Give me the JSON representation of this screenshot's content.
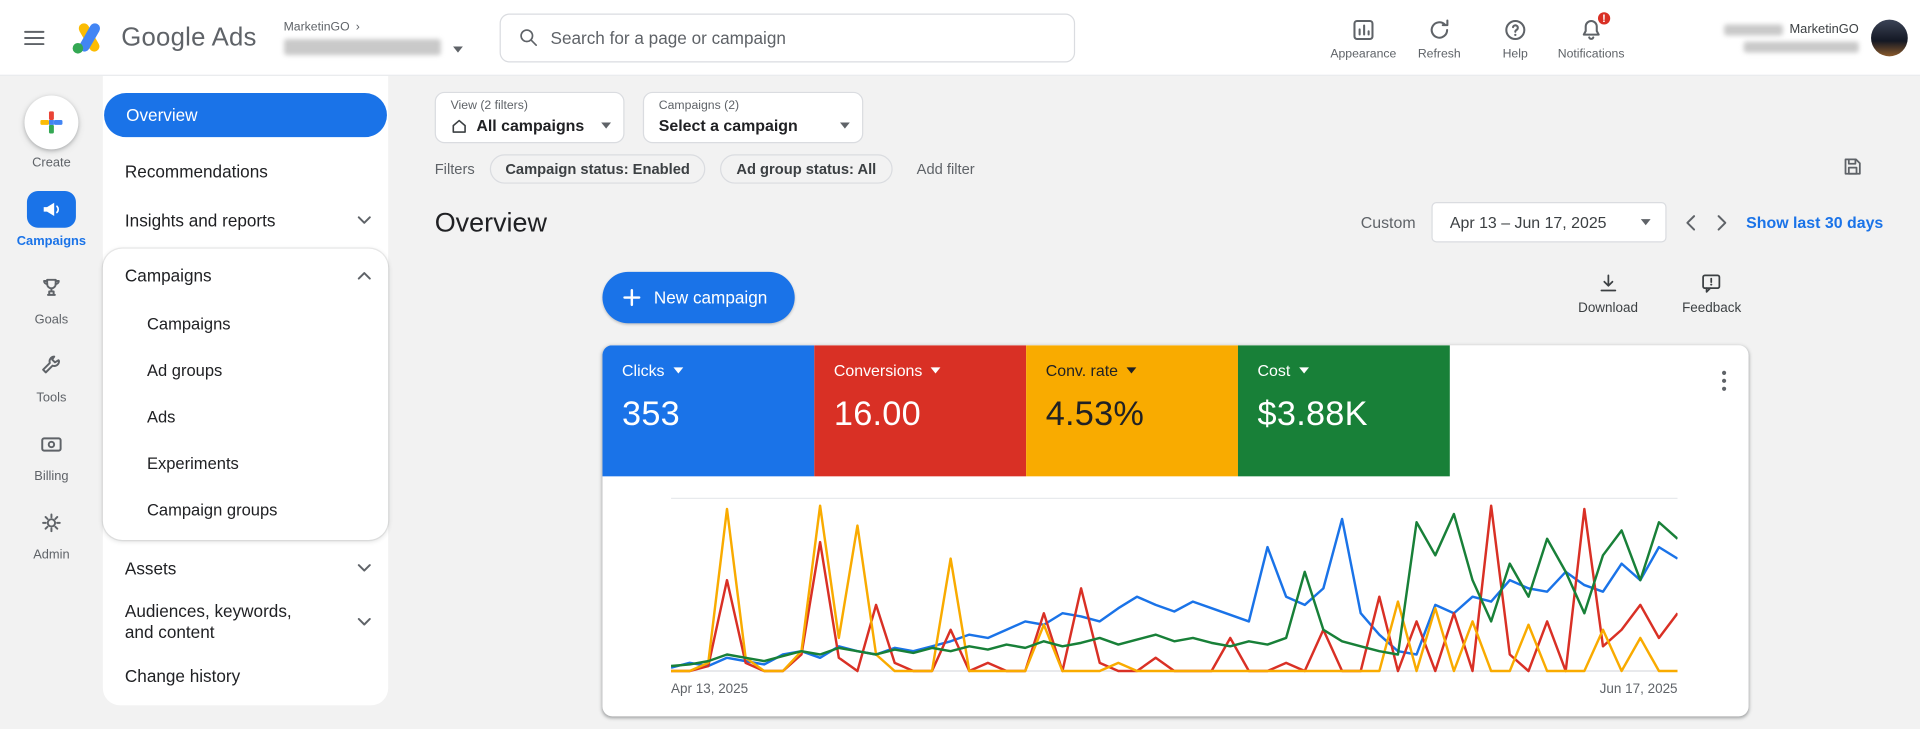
{
  "topbar": {
    "brand": "Google Ads",
    "account_breadcrumb": "MarketinGO",
    "search_placeholder": "Search for a page or campaign",
    "actions": {
      "appearance": "Appearance",
      "refresh": "Refresh",
      "help": "Help",
      "notifications": "Notifications",
      "notification_badge": "!"
    },
    "profile_org": "MarketinGO"
  },
  "left_rail": {
    "create": "Create",
    "campaigns": "Campaigns",
    "goals": "Goals",
    "tools": "Tools",
    "billing": "Billing",
    "admin": "Admin"
  },
  "sidebar": {
    "overview": "Overview",
    "recommendations": "Recommendations",
    "insights": "Insights and reports",
    "campaigns_header": "Campaigns",
    "campaigns_children": [
      "Campaigns",
      "Ad groups",
      "Ads",
      "Experiments",
      "Campaign groups"
    ],
    "assets": "Assets",
    "audiences": "Audiences, keywords, and content",
    "change_history": "Change history"
  },
  "filter_bar": {
    "view_label": "View (2 filters)",
    "view_value": "All campaigns",
    "campaign_label": "Campaigns (2)",
    "campaign_value": "Select a campaign",
    "filters_label": "Filters",
    "chips": [
      "Campaign status: Enabled",
      "Ad group status: All"
    ],
    "add_filter": "Add filter"
  },
  "page": {
    "title": "Overview",
    "date_mode": "Custom",
    "date_range": "Apr 13 – Jun 17, 2025",
    "quick_range_link": "Show last 30 days",
    "new_campaign": "New campaign",
    "download": "Download",
    "feedback": "Feedback"
  },
  "metrics": [
    {
      "label": "Clicks",
      "value": "353",
      "bg": "#1a73e8",
      "fg": "#ffffff"
    },
    {
      "label": "Conversions",
      "value": "16.00",
      "bg": "#d93025",
      "fg": "#ffffff"
    },
    {
      "label": "Conv. rate",
      "value": "4.53%",
      "bg": "#f9ab00",
      "fg": "#202124"
    },
    {
      "label": "Cost",
      "value": "$3.88K",
      "bg": "#188038",
      "fg": "#ffffff"
    }
  ],
  "chart_data": {
    "type": "line",
    "x_axis": {
      "start_label": "Apr 13, 2025",
      "end_label": "Jun 17, 2025"
    },
    "y_axis_note": "no y-axis tick labels visible; values are relative heights 0-100 estimated from pixels",
    "grid": "top and bottom hairlines only",
    "legend": "colored metric cards above chart act as legend",
    "series": [
      {
        "name": "Clicks",
        "color": "#1a73e8",
        "values": [
          2,
          5,
          3,
          8,
          6,
          4,
          10,
          12,
          8,
          15,
          12,
          10,
          14,
          12,
          15,
          18,
          22,
          20,
          25,
          30,
          28,
          35,
          33,
          30,
          38,
          45,
          40,
          36,
          42,
          38,
          34,
          30,
          75,
          45,
          40,
          50,
          92,
          35,
          22,
          12,
          10,
          40,
          35,
          45,
          42,
          55,
          50,
          48,
          60,
          52,
          48,
          65,
          55,
          75,
          68
        ]
      },
      {
        "name": "Conversions",
        "color": "#d93025",
        "values": [
          0,
          0,
          3,
          55,
          5,
          0,
          0,
          10,
          78,
          8,
          0,
          40,
          5,
          0,
          0,
          25,
          0,
          5,
          0,
          0,
          35,
          0,
          50,
          5,
          0,
          0,
          8,
          0,
          0,
          0,
          20,
          0,
          0,
          5,
          0,
          25,
          0,
          0,
          45,
          0,
          30,
          0,
          35,
          0,
          100,
          10,
          0,
          30,
          0,
          98,
          15,
          25,
          40,
          20,
          35
        ]
      },
      {
        "name": "Conv. rate",
        "color": "#f9ab00",
        "values": [
          0,
          0,
          5,
          98,
          8,
          0,
          0,
          12,
          100,
          20,
          88,
          10,
          0,
          0,
          0,
          68,
          0,
          0,
          0,
          0,
          28,
          0,
          0,
          0,
          5,
          0,
          0,
          0,
          0,
          0,
          0,
          0,
          0,
          0,
          0,
          0,
          0,
          0,
          0,
          42,
          0,
          38,
          0,
          30,
          0,
          0,
          28,
          0,
          0,
          0,
          25,
          0,
          20,
          0,
          0
        ]
      },
      {
        "name": "Cost",
        "color": "#188038",
        "values": [
          3,
          4,
          6,
          10,
          8,
          6,
          9,
          12,
          10,
          14,
          12,
          10,
          13,
          11,
          14,
          12,
          15,
          13,
          16,
          14,
          18,
          15,
          17,
          20,
          16,
          19,
          22,
          18,
          20,
          17,
          15,
          18,
          16,
          20,
          60,
          25,
          18,
          15,
          12,
          10,
          90,
          70,
          95,
          55,
          30,
          65,
          45,
          80,
          60,
          35,
          70,
          85,
          55,
          90,
          80
        ]
      }
    ]
  }
}
